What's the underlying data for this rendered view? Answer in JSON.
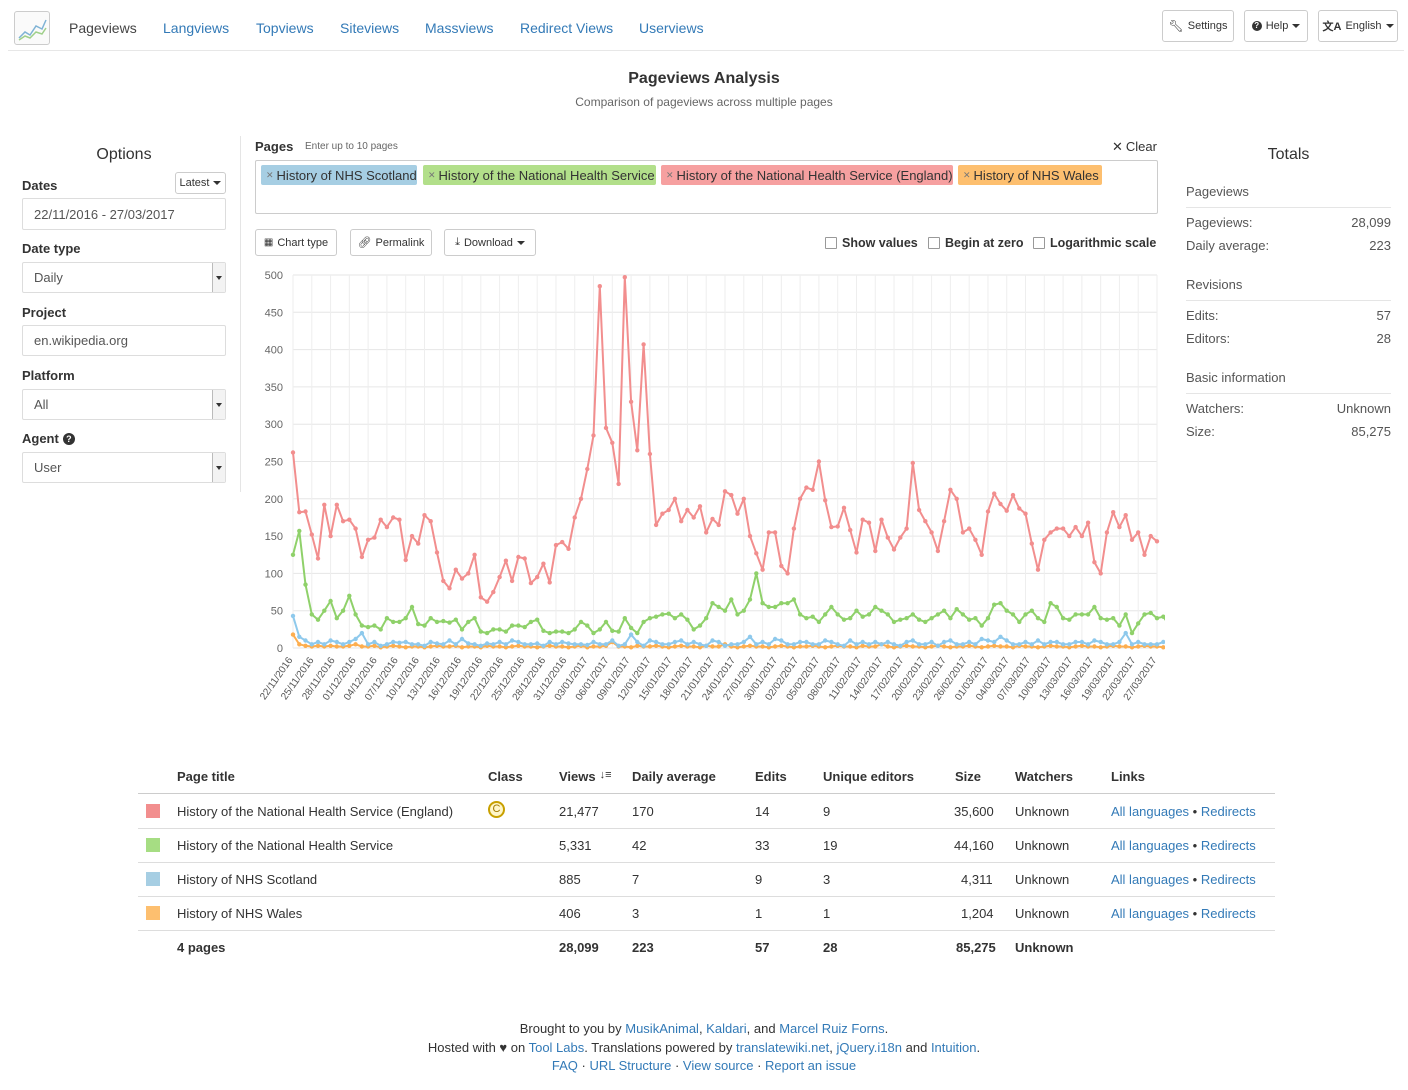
{
  "nav": {
    "items": [
      "Pageviews",
      "Langviews",
      "Topviews",
      "Siteviews",
      "Massviews",
      "Redirect Views",
      "Userviews"
    ],
    "settings": "Settings",
    "help": "Help",
    "language": "English"
  },
  "header": {
    "title": "Pageviews Analysis",
    "subtitle": "Comparison of pageviews across multiple pages"
  },
  "options": {
    "heading": "Options",
    "dates_label": "Dates",
    "latest_button": "Latest",
    "dates_value": "22/11/2016 - 27/03/2017",
    "date_type_label": "Date type",
    "date_type_value": "Daily",
    "project_label": "Project",
    "project_value": "en.wikipedia.org",
    "platform_label": "Platform",
    "platform_value": "All",
    "agent_label": "Agent",
    "agent_value": "User"
  },
  "pages": {
    "label": "Pages",
    "hint": "Enter up to 10 pages",
    "clear": "Clear",
    "tags": [
      {
        "text": "History of NHS Scotland",
        "color": "#a6cee3"
      },
      {
        "text": "History of the National Health Service",
        "color": "#b2df8a"
      },
      {
        "text": "History of the National Health Service (England)",
        "color": "#f6a0a0"
      },
      {
        "text": "History of NHS Wales",
        "color": "#fdbf6f"
      }
    ]
  },
  "toolbar": {
    "chart_type": "Chart type",
    "permalink": "Permalink",
    "download": "Download",
    "show_values": "Show values",
    "begin_at_zero": "Begin at zero",
    "log_scale": "Logarithmic scale"
  },
  "totals": {
    "heading": "Totals",
    "pageviews_heading": "Pageviews",
    "pageviews_label": "Pageviews:",
    "pageviews_value": "28,099",
    "daily_avg_label": "Daily average:",
    "daily_avg_value": "223",
    "revisions_heading": "Revisions",
    "edits_label": "Edits:",
    "edits_value": "57",
    "editors_label": "Editors:",
    "editors_value": "28",
    "basic_heading": "Basic information",
    "watchers_label": "Watchers:",
    "watchers_value": "Unknown",
    "size_label": "Size:",
    "size_value": "85,275"
  },
  "chart_data": {
    "type": "line",
    "ylim": [
      0,
      500
    ],
    "yticks": [
      0,
      50,
      100,
      150,
      200,
      250,
      300,
      350,
      400,
      450,
      500
    ],
    "xlabels": [
      "22/11/2016",
      "25/11/2016",
      "28/11/2016",
      "01/12/2016",
      "04/12/2016",
      "07/12/2016",
      "10/12/2016",
      "13/12/2016",
      "16/12/2016",
      "19/12/2016",
      "22/12/2016",
      "25/12/2016",
      "28/12/2016",
      "31/12/2016",
      "03/01/2017",
      "06/01/2017",
      "09/01/2017",
      "12/01/2017",
      "15/01/2017",
      "18/01/2017",
      "21/01/2017",
      "24/01/2017",
      "27/01/2017",
      "30/01/2017",
      "02/02/2017",
      "05/02/2017",
      "08/02/2017",
      "11/02/2017",
      "14/02/2017",
      "17/02/2017",
      "20/02/2017",
      "23/02/2017",
      "26/02/2017",
      "01/03/2017",
      "04/03/2017",
      "07/03/2017",
      "10/03/2017",
      "13/03/2017",
      "16/03/2017",
      "19/03/2017",
      "22/03/2017",
      "27/03/2017"
    ],
    "series": [
      {
        "name": "History of the National Health Service (England)",
        "color": "#f28e8e",
        "values": [
          262,
          182,
          183,
          152,
          120,
          192,
          150,
          192,
          170,
          172,
          160,
          122,
          145,
          148,
          172,
          162,
          175,
          172,
          118,
          150,
          140,
          178,
          170,
          128,
          90,
          80,
          105,
          93,
          100,
          125,
          68,
          62,
          75,
          95,
          117,
          90,
          122,
          120,
          87,
          95,
          113,
          88,
          138,
          142,
          133,
          175,
          200,
          240,
          285,
          485,
          295,
          275,
          220,
          497,
          330,
          265,
          407,
          260,
          165,
          180,
          185,
          200,
          170,
          185,
          175,
          190,
          155,
          173,
          165,
          210,
          205,
          180,
          200,
          150,
          127,
          105,
          155,
          155,
          110,
          100,
          160,
          200,
          215,
          212,
          250,
          198,
          162,
          163,
          188,
          158,
          128,
          172,
          168,
          130,
          172,
          148,
          132,
          148,
          160,
          248,
          185,
          170,
          155,
          130,
          170,
          212,
          200,
          155,
          160,
          145,
          125,
          183,
          207,
          193,
          184,
          205,
          187,
          180,
          140,
          105,
          145,
          155,
          160,
          160,
          150,
          162,
          150,
          168,
          115,
          100,
          155,
          182,
          162,
          178,
          145,
          155,
          125,
          150,
          143
        ]
      },
      {
        "name": "History of the National Health Service",
        "color": "#8fd16a",
        "values": [
          125,
          157,
          85,
          45,
          38,
          50,
          63,
          40,
          50,
          70,
          45,
          30,
          28,
          30,
          25,
          40,
          35,
          35,
          40,
          55,
          32,
          30,
          40,
          35,
          36,
          34,
          38,
          25,
          35,
          40,
          22,
          20,
          25,
          25,
          22,
          30,
          30,
          28,
          35,
          38,
          23,
          20,
          22,
          22,
          20,
          25,
          35,
          30,
          20,
          25,
          35,
          23,
          22,
          40,
          27,
          20,
          35,
          40,
          42,
          45,
          46,
          40,
          45,
          38,
          25,
          30,
          40,
          60,
          55,
          50,
          65,
          45,
          50,
          65,
          100,
          60,
          55,
          55,
          60,
          60,
          65,
          45,
          40,
          42,
          35,
          45,
          55,
          45,
          38,
          40,
          50,
          42,
          45,
          55,
          50,
          45,
          35,
          38,
          40,
          45,
          38,
          35,
          40,
          45,
          50,
          40,
          52,
          45,
          38,
          40,
          30,
          40,
          58,
          60,
          50,
          45,
          35,
          45,
          50,
          40,
          35,
          60,
          55,
          40,
          38,
          45,
          45,
          45,
          55,
          40,
          38,
          40,
          30,
          45,
          20,
          33,
          45,
          47,
          40,
          42,
          30,
          50,
          50,
          30,
          35,
          52,
          40
        ]
      },
      {
        "name": "History of NHS Scotland",
        "color": "#8ec9ec",
        "values": [
          43,
          15,
          10,
          5,
          8,
          5,
          10,
          8,
          5,
          8,
          12,
          20,
          5,
          8,
          3,
          5,
          8,
          7,
          8,
          5,
          5,
          3,
          8,
          6,
          5,
          10,
          5,
          12,
          6,
          5,
          3,
          6,
          5,
          8,
          5,
          10,
          8,
          5,
          5,
          6,
          3,
          8,
          5,
          8,
          6,
          5,
          5,
          4,
          8,
          5,
          5,
          10,
          3,
          5,
          18,
          8,
          3,
          10,
          8,
          5,
          5,
          8,
          10,
          5,
          8,
          5,
          3,
          10,
          8,
          3,
          5,
          5,
          8,
          15,
          5,
          8,
          5,
          12,
          10,
          5,
          5,
          8,
          8,
          5,
          5,
          10,
          8,
          5,
          3,
          10,
          5,
          8,
          5,
          8,
          5,
          8,
          5,
          3,
          8,
          10,
          5,
          5,
          8,
          3,
          8,
          10,
          5,
          5,
          8,
          5,
          12,
          10,
          8,
          15,
          10,
          5,
          5,
          8,
          5,
          10,
          5,
          8,
          8,
          5,
          5,
          8,
          8,
          5,
          10,
          8,
          5,
          5,
          8,
          20,
          5,
          8,
          5,
          5,
          5,
          8
        ]
      },
      {
        "name": "History of NHS Wales",
        "color": "#fdae4f",
        "values": [
          18,
          5,
          3,
          2,
          3,
          2,
          3,
          2,
          2,
          3,
          5,
          2,
          2,
          3,
          1,
          2,
          3,
          2,
          1,
          2,
          2,
          1,
          2,
          3,
          2,
          2,
          3,
          1,
          2,
          2,
          1,
          3,
          2,
          2,
          1,
          2,
          3,
          2,
          2,
          1,
          2,
          3,
          2,
          2,
          1,
          2,
          3,
          1,
          2,
          2,
          3,
          8,
          2,
          2,
          1,
          3,
          2,
          2,
          3,
          2,
          1,
          2,
          3,
          2,
          2,
          1,
          3,
          2,
          2,
          5,
          2,
          1,
          2,
          3,
          2,
          2,
          1,
          2,
          3,
          2,
          1,
          2,
          2,
          3,
          2,
          1,
          2,
          3,
          2,
          2,
          1,
          3,
          2,
          2,
          5,
          2,
          1,
          2,
          3,
          2,
          2,
          1,
          2,
          3,
          2,
          1,
          2,
          2,
          3,
          2,
          1,
          2,
          3,
          2,
          2,
          1,
          3,
          2,
          2,
          1,
          2,
          3,
          2,
          2,
          1,
          2,
          3,
          2,
          2,
          1,
          2,
          3,
          2,
          2,
          1,
          2,
          3,
          2,
          2,
          1,
          2
        ]
      }
    ]
  },
  "table": {
    "headers": {
      "page_title": "Page title",
      "class": "Class",
      "views": "Views",
      "daily_average": "Daily average",
      "edits": "Edits",
      "unique_editors": "Unique editors",
      "size": "Size",
      "watchers": "Watchers",
      "links": "Links"
    },
    "rows": [
      {
        "color": "#f28e8e",
        "title": "History of the National Health Service (England)",
        "class_icon": "copyright-icon",
        "views": "21,477",
        "daily": "170",
        "edits": "14",
        "editors": "9",
        "size": "35,600",
        "watchers": "Unknown",
        "link1": "All languages",
        "link2": "Redirects"
      },
      {
        "color": "#a6dd83",
        "title": "History of the National Health Service",
        "class_icon": "",
        "views": "5,331",
        "daily": "42",
        "edits": "33",
        "editors": "19",
        "size": "44,160",
        "watchers": "Unknown",
        "link1": "All languages",
        "link2": "Redirects"
      },
      {
        "color": "#a6cee3",
        "title": "History of NHS Scotland",
        "class_icon": "",
        "views": "885",
        "daily": "7",
        "edits": "9",
        "editors": "3",
        "size": "4,311",
        "watchers": "Unknown",
        "link1": "All languages",
        "link2": "Redirects"
      },
      {
        "color": "#fdbf6f",
        "title": "History of NHS Wales",
        "class_icon": "",
        "views": "406",
        "daily": "3",
        "edits": "1",
        "editors": "1",
        "size": "1,204",
        "watchers": "Unknown",
        "link1": "All languages",
        "link2": "Redirects"
      }
    ],
    "totals": {
      "label": "4 pages",
      "views": "28,099",
      "daily": "223",
      "edits": "57",
      "editors": "28",
      "size": "85,275",
      "watchers": "Unknown"
    }
  },
  "footer": {
    "line1_prefix": "Brought to you by",
    "author1": "MusikAnimal",
    "author2": "Kaldari",
    "and": ", and",
    "author3": "Marcel Ruiz Forns",
    "hosted_prefix": "Hosted with ♥ on",
    "tool_labs": "Tool Labs",
    "translations": ". Translations powered by",
    "translatewiki": "translatewiki.net",
    "jquery": "jQuery.i18n",
    "and2": "and",
    "intuition": "Intuition",
    "faq": "FAQ",
    "url_structure": "URL Structure",
    "view_source": "View source",
    "report": "Report an issue"
  }
}
